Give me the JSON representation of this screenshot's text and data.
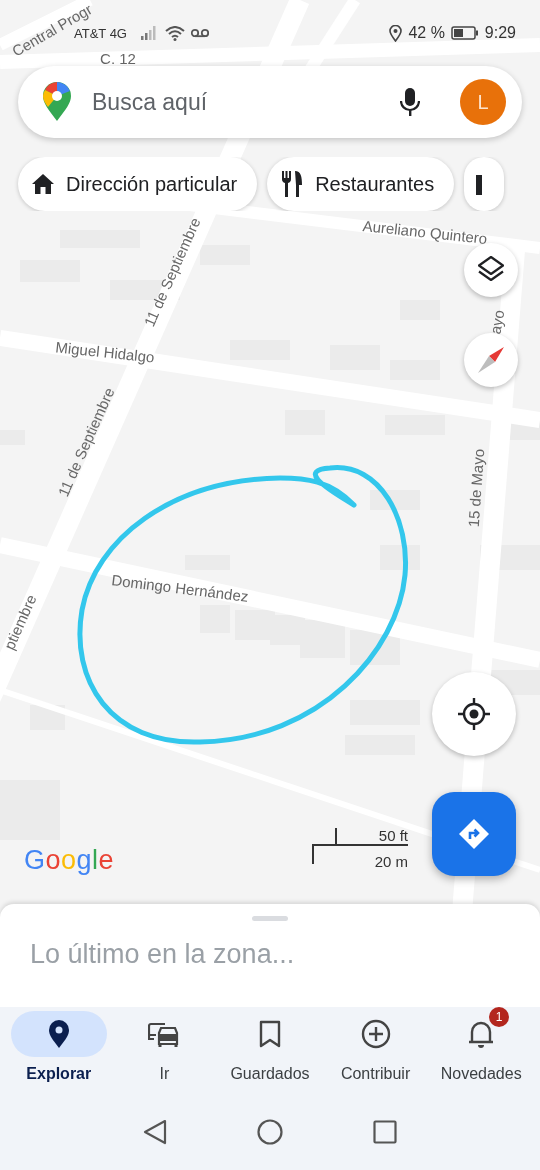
{
  "status_bar": {
    "carrier": "AT&T 4G",
    "battery": "42 %",
    "time": "9:29"
  },
  "search": {
    "placeholder": "Busca aquí",
    "avatar": "L"
  },
  "chips": [
    {
      "label": "Dirección particular"
    },
    {
      "label": "Restaurantes"
    }
  ],
  "map_labels": [
    "Central Progr",
    "C. 12",
    "Aureliano Quintero",
    "11 de Septiembre",
    "Miguel Hidalgo",
    "11 de Septiembre",
    "ayo",
    "15 de Mayo",
    "Domingo Hernández",
    "ptiembre"
  ],
  "logo": "Google",
  "scale": {
    "imperial": "50 ft",
    "metric": "20 m"
  },
  "sheet": {
    "title": "Lo último en la zona..."
  },
  "nav": [
    {
      "label": "Explorar",
      "selected": true
    },
    {
      "label": "Ir",
      "selected": false
    },
    {
      "label": "Guardados",
      "selected": false
    },
    {
      "label": "Contribuir",
      "selected": false
    },
    {
      "label": "Novedades",
      "selected": false,
      "badge": "1"
    }
  ]
}
